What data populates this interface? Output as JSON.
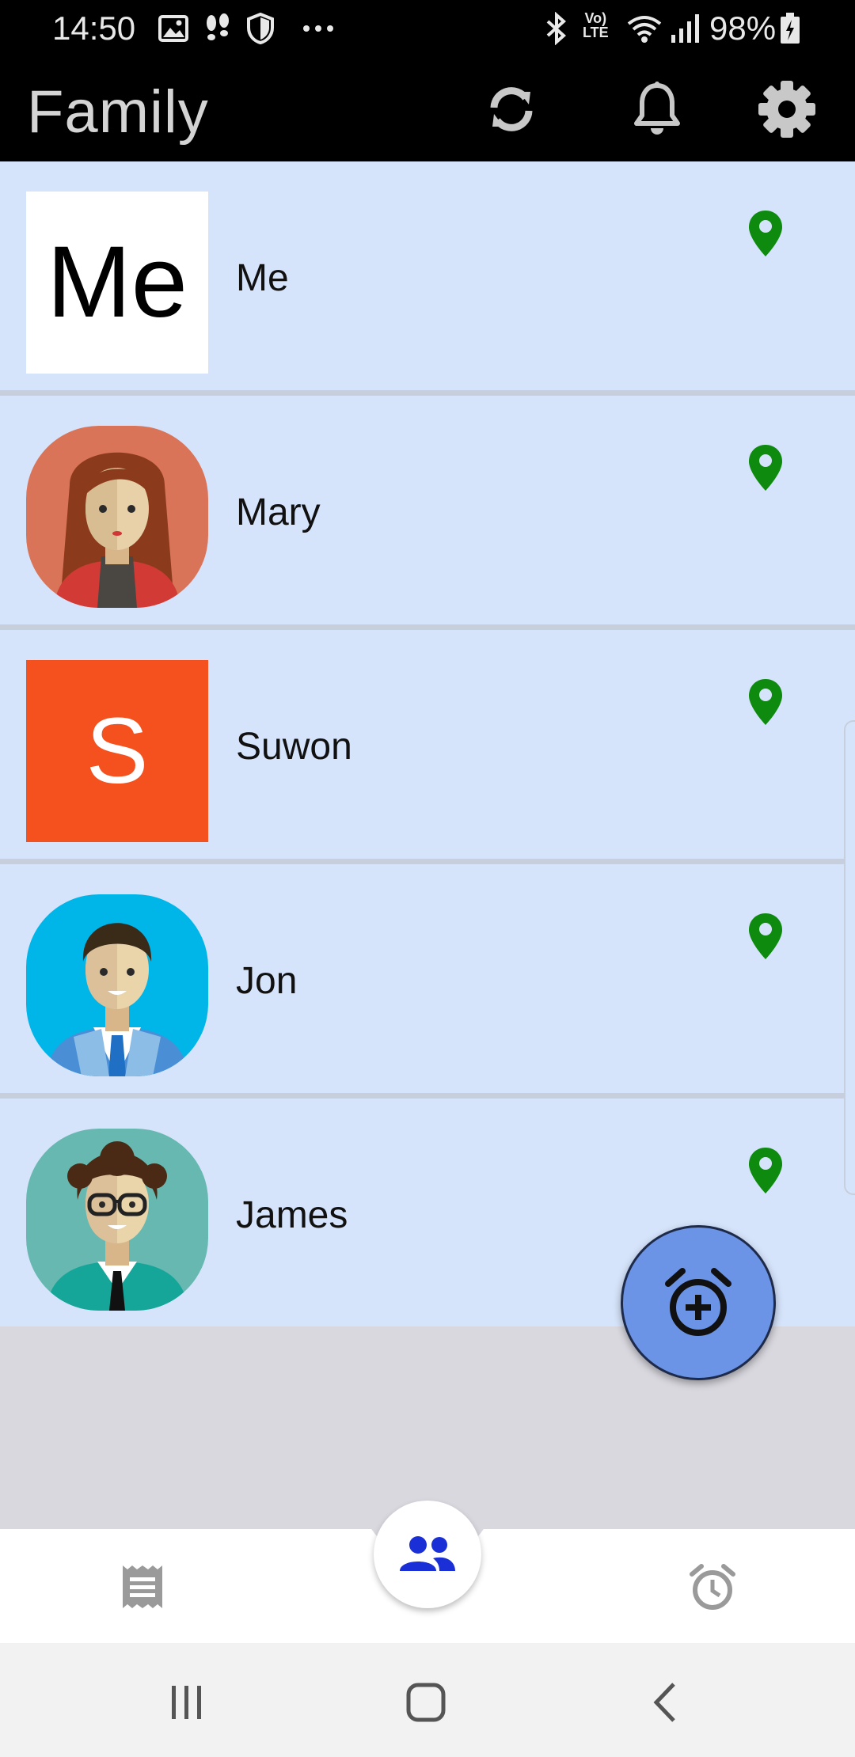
{
  "status_bar": {
    "time": "14:50",
    "battery": "98%",
    "icons": [
      "gallery-icon",
      "footprints-icon",
      "shield-icon",
      "more-dots-icon",
      "bluetooth-icon",
      "volte-icon",
      "wifi-icon",
      "signal-icon",
      "battery-charging-icon"
    ],
    "volte_label_top": "Vo)",
    "volte_label_bottom": "LTE"
  },
  "app_bar": {
    "title": "Family",
    "actions": [
      "refresh-icon",
      "bell-icon",
      "settings-icon"
    ]
  },
  "members": [
    {
      "name": "Me",
      "avatar_type": "text",
      "avatar_text": "Me",
      "avatar_bg": "#ffffff",
      "avatar_fg": "#000000",
      "location_icon": "location-pin-icon"
    },
    {
      "name": "Mary",
      "avatar_type": "woman-avatar",
      "avatar_bg": "#d97458",
      "location_icon": "location-pin-icon"
    },
    {
      "name": "Suwon",
      "avatar_type": "text",
      "avatar_text": "S",
      "avatar_bg": "#f4511e",
      "avatar_fg": "#ffffff",
      "location_icon": "location-pin-icon"
    },
    {
      "name": "Jon",
      "avatar_type": "man-avatar",
      "avatar_bg": "#00b5e8",
      "location_icon": "location-pin-icon"
    },
    {
      "name": "James",
      "avatar_type": "glasses-man-avatar",
      "avatar_bg": "#66b8b0",
      "location_icon": "location-pin-icon"
    }
  ],
  "fab": {
    "icon": "add-alarm-icon",
    "color": "#6b94e6"
  },
  "bottom_nav": {
    "items": [
      {
        "icon": "receipt-icon",
        "active": false
      },
      {
        "icon": "people-icon",
        "active": true
      },
      {
        "icon": "alarm-icon",
        "active": false
      }
    ],
    "active_color": "#1a2fd6",
    "inactive_color": "#9a9a9a"
  },
  "system_nav": [
    "recent-apps-icon",
    "home-icon",
    "back-icon"
  ],
  "colors": {
    "row_bg": "#d6e4fb",
    "pin": "#0e8a0e",
    "app_bar_bg": "#000000"
  }
}
